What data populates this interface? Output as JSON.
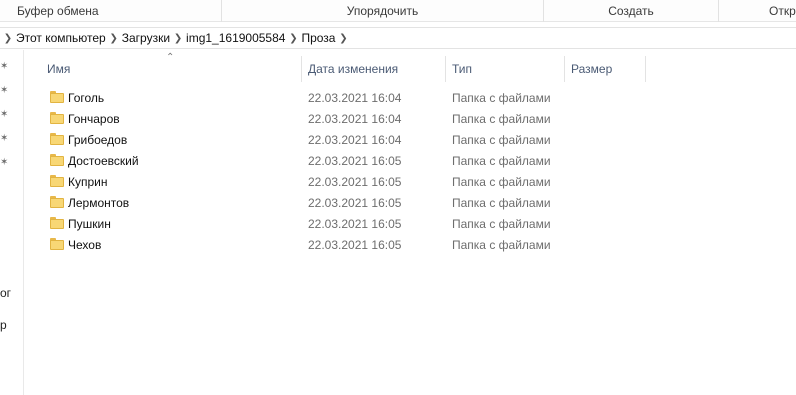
{
  "ribbon": {
    "clipboard": "Буфер обмена",
    "organize": "Упорядочить",
    "create": "Создать",
    "open": "Откр"
  },
  "breadcrumb": [
    "Этот компьютер",
    "Загрузки",
    "img1_1619005584",
    "Проза"
  ],
  "nav": {
    "partial1": "ог",
    "partial2": "р"
  },
  "columns": {
    "name": "Имя",
    "date": "Дата изменения",
    "type": "Тип",
    "size": "Размер"
  },
  "files": [
    {
      "name": "Гоголь",
      "date": "22.03.2021 16:04",
      "type": "Папка с файлами"
    },
    {
      "name": "Гончаров",
      "date": "22.03.2021 16:04",
      "type": "Папка с файлами"
    },
    {
      "name": "Грибоедов",
      "date": "22.03.2021 16:04",
      "type": "Папка с файлами"
    },
    {
      "name": "Достоевский",
      "date": "22.03.2021 16:05",
      "type": "Папка с файлами"
    },
    {
      "name": "Куприн",
      "date": "22.03.2021 16:05",
      "type": "Папка с файлами"
    },
    {
      "name": "Лермонтов",
      "date": "22.03.2021 16:05",
      "type": "Папка с файлами"
    },
    {
      "name": "Пушкин",
      "date": "22.03.2021 16:05",
      "type": "Папка с файлами"
    },
    {
      "name": "Чехов",
      "date": "22.03.2021 16:05",
      "type": "Папка с файлами"
    }
  ],
  "colors": {
    "folder": "#f8d775",
    "header_text": "#4a5a74",
    "secondary_text": "#6d6d6d"
  },
  "icons": {
    "folder": "folder-icon",
    "pin": "pin-icon",
    "chevron": "chevron-right-icon",
    "sort": "sort-up-icon"
  }
}
